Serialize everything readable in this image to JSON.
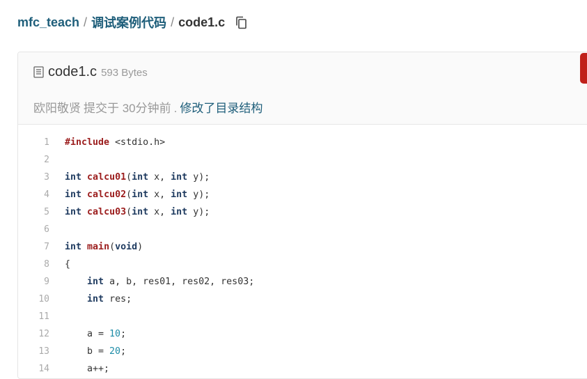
{
  "breadcrumb": {
    "repo": "mfc_teach",
    "folder": "调试案例代码",
    "file": "code1.c",
    "separator": "/"
  },
  "file": {
    "name": "code1.c",
    "size": "593 Bytes"
  },
  "commit": {
    "author": "欧阳敬贤",
    "action": "提交于 30分钟前",
    "separator": ".",
    "message": "修改了目录结构"
  },
  "code": {
    "line_numbers": [
      "1",
      "2",
      "3",
      "4",
      "5",
      "6",
      "7",
      "8",
      "9",
      "10",
      "11",
      "12",
      "13",
      "14"
    ],
    "lines": [
      "#include <stdio.h>",
      "",
      "int calcu01(int x, int y);",
      "int calcu02(int x, int y);",
      "int calcu03(int x, int y);",
      "",
      "int main(void)",
      "{",
      "    int a, b, res01, res02, res03;",
      "    int res;",
      "",
      "    a = 10;",
      "    b = 20;",
      "    a++;"
    ]
  },
  "icons": {
    "copy": "copy-icon",
    "file": "file-icon"
  },
  "colors": {
    "link": "#1e5e7a",
    "keyword": "#1e3a5f",
    "function": "#9b1c1c",
    "number": "#1d8ca7"
  }
}
